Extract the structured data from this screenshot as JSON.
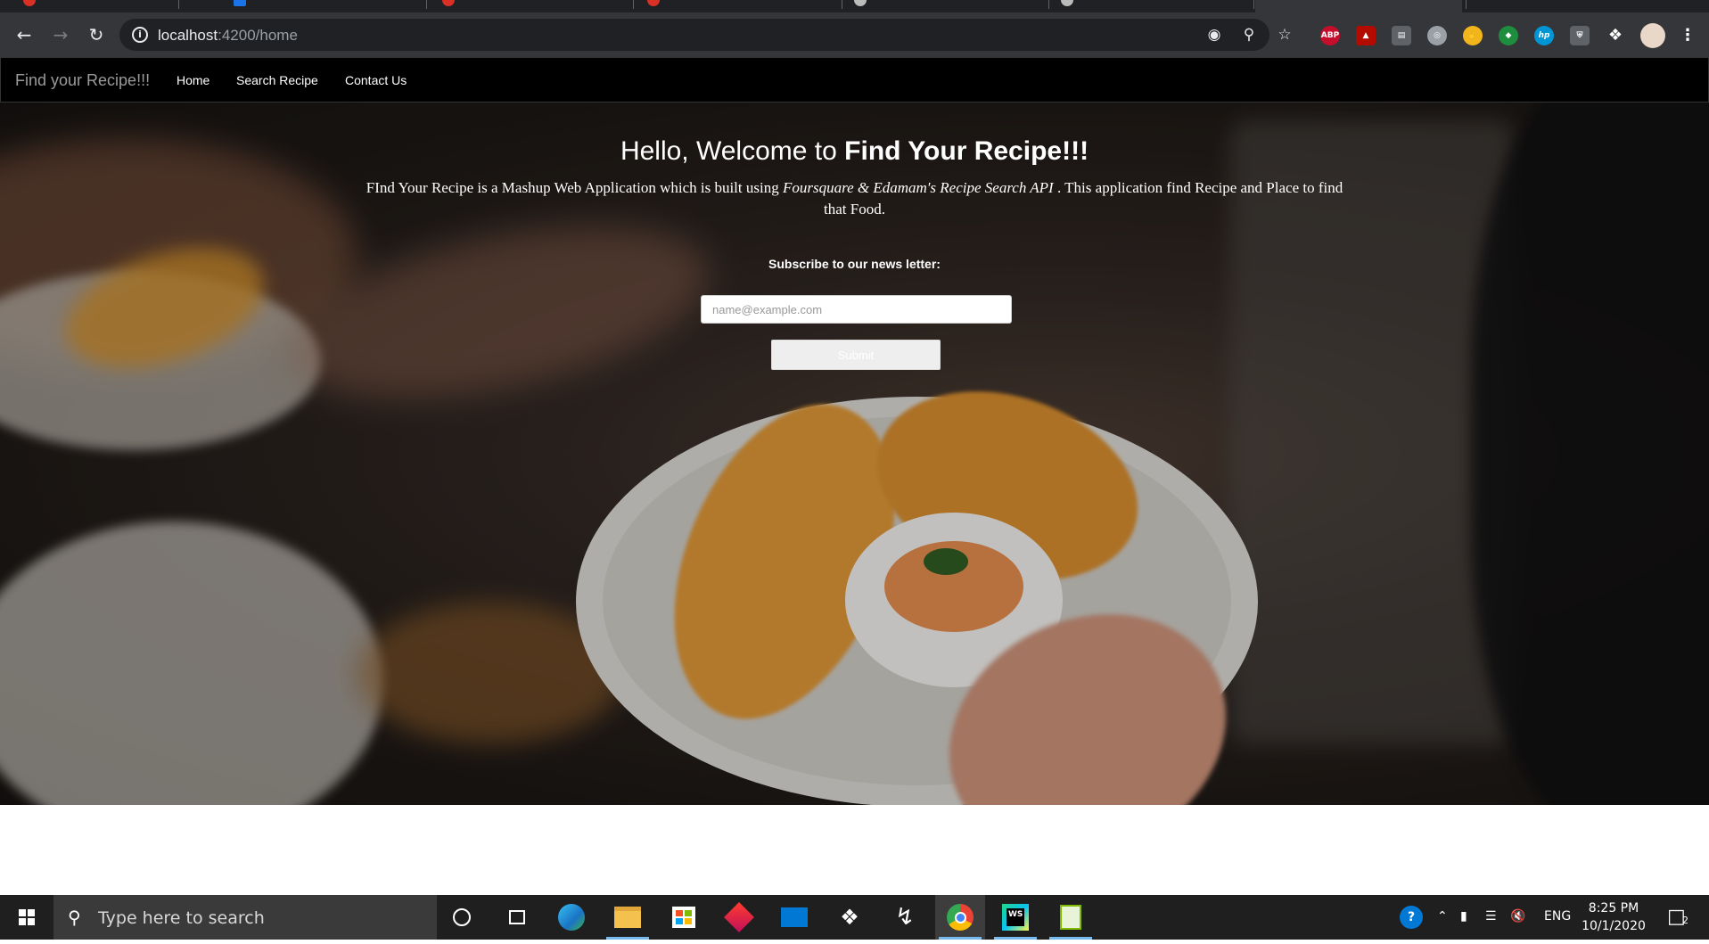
{
  "browser": {
    "url_host": "localhost",
    "url_path": ":4200/home",
    "extensions": [
      "ABP",
      "hp"
    ]
  },
  "app": {
    "brand": "Find your Recipe!!!",
    "nav": [
      "Home",
      "Search Recipe",
      "Contact Us"
    ],
    "hero": {
      "headline_prefix": "Hello, Welcome to ",
      "headline_strong": "Find Your Recipe!!!",
      "description_start": "FInd Your Recipe is a Mashup Web Application which is built using ",
      "description_italic": "Foursquare & Edamam's Recipe Search API",
      "description_end": " . This application find Recipe and Place to find that Food.",
      "subscribe_label": "Subscribe to our news letter:",
      "email_placeholder": "name@example.com",
      "submit_label": "Submit"
    }
  },
  "taskbar": {
    "search_placeholder": "Type here to search",
    "language": "ENG",
    "time": "8:25 PM",
    "date": "10/1/2020",
    "notification_count": "2"
  },
  "colors": {
    "navbar_bg": "#000000",
    "brand_text": "#9a9a9a",
    "chrome_toolbar": "#35363a",
    "taskbar_bg": "#1f1f1f",
    "taskbar_accent": "#76b9ed"
  }
}
